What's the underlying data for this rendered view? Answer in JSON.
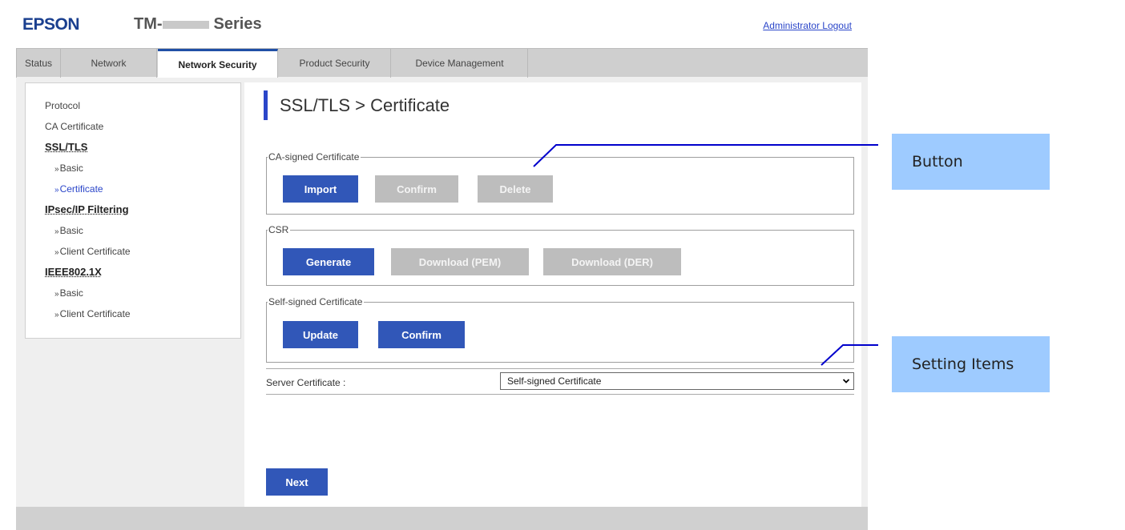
{
  "header": {
    "brand": "EPSON",
    "model_prefix": "TM-",
    "model_suffix": "Series",
    "logout_label": "Administrator Logout"
  },
  "tabs": [
    {
      "label": "Status",
      "active": false
    },
    {
      "label": "Network",
      "active": false
    },
    {
      "label": "Network Security",
      "active": true
    },
    {
      "label": "Product Security",
      "active": false
    },
    {
      "label": "Device Management",
      "active": false
    }
  ],
  "sidebar": {
    "items": [
      {
        "label": "Protocol",
        "kind": "item"
      },
      {
        "label": "CA Certificate",
        "kind": "item"
      },
      {
        "label": "SSL/TLS",
        "kind": "group"
      },
      {
        "label": "Basic",
        "kind": "sub"
      },
      {
        "label": "Certificate",
        "kind": "sub",
        "active": true
      },
      {
        "label": "IPsec/IP Filtering",
        "kind": "group"
      },
      {
        "label": "Basic",
        "kind": "sub"
      },
      {
        "label": "Client Certificate",
        "kind": "sub"
      },
      {
        "label": "IEEE802.1X",
        "kind": "group"
      },
      {
        "label": "Basic",
        "kind": "sub"
      },
      {
        "label": "Client Certificate",
        "kind": "sub"
      }
    ],
    "sub_marker": "»"
  },
  "main": {
    "title": "SSL/TLS > Certificate",
    "ca_signed": {
      "legend": "CA-signed Certificate",
      "import_label": "Import",
      "confirm_label": "Confirm",
      "delete_label": "Delete"
    },
    "csr": {
      "legend": "CSR",
      "generate_label": "Generate",
      "download_pem_label": "Download (PEM)",
      "download_der_label": "Download (DER)"
    },
    "self_signed": {
      "legend": "Self-signed Certificate",
      "update_label": "Update",
      "confirm_label": "Confirm"
    },
    "server_certificate": {
      "label": "Server Certificate :",
      "selected": "Self-signed Certificate"
    },
    "next_label": "Next"
  },
  "callouts": {
    "button_label": "Button",
    "setting_items_label": "Setting Items"
  },
  "colors": {
    "accent": "#3157b8",
    "brand": "#1a3f8f",
    "disabled": "#bdbdbd",
    "callout_bg": "#9ecbff",
    "leader_line": "#0000cc"
  }
}
